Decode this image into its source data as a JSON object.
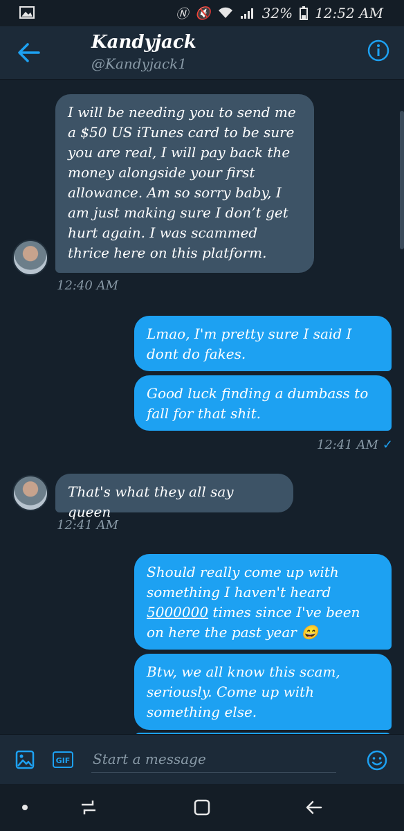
{
  "status_bar": {
    "battery": "32%",
    "time": "12:52 AM",
    "icons": [
      "image-icon",
      "nfc-icon",
      "mute-icon",
      "wifi-icon",
      "signal-icon",
      "battery-icon"
    ]
  },
  "header": {
    "name": "Kandyjack",
    "handle": "@Kandyjack1",
    "icons": [
      "back-arrow-icon",
      "info-icon"
    ]
  },
  "messages": [
    {
      "from": "them",
      "text": "I will be needing you to send me a $50 US iTunes card to be sure you are real, I will pay back the money alongside your first allowance. Am so sorry baby, I am just making sure I don’t get hurt again. I was scammed thrice here on this platform."
    },
    {
      "time": "12:40 AM"
    },
    {
      "from": "me",
      "text": "Lmao, I'm pretty sure I said I dont do fakes."
    },
    {
      "from": "me",
      "text": "Good luck finding a dumbass to fall for that shit."
    },
    {
      "time": "12:41 AM",
      "read": "✓"
    },
    {
      "from": "them",
      "text": "That's what they all say queen"
    },
    {
      "time": "12:41 AM"
    },
    {
      "from": "me",
      "text_parts": [
        "Should really come up with something I haven't heard ",
        "5000000",
        " times since I've been on here the past year",
        "😄"
      ]
    },
    {
      "from": "me",
      "text": "Btw, we all know this scam, seriously. Come up with something else."
    }
  ],
  "composer": {
    "placeholder": "Start a message",
    "gif_label": "GIF",
    "icons": [
      "image-icon",
      "gif-icon",
      "emoji-icon"
    ]
  },
  "colors": {
    "background": "#15202b",
    "header": "#1c2a38",
    "received_bubble": "#3d5366",
    "sent_bubble": "#1da1f2",
    "secondary_text": "#8899a6"
  }
}
